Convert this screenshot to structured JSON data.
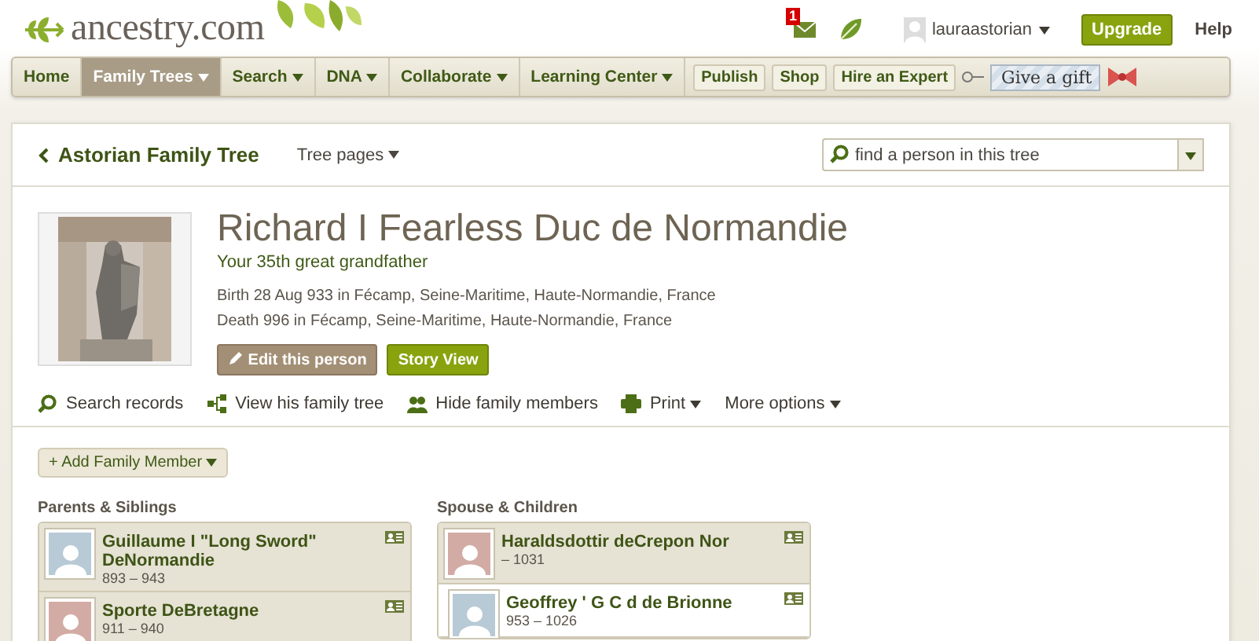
{
  "header": {
    "logo": "ancestry.com",
    "message_count": "1",
    "username": "lauraastorian",
    "upgrade": "Upgrade",
    "help": "Help"
  },
  "nav": [
    {
      "label": "Home",
      "kind": "tab",
      "selected": false,
      "menu": false
    },
    {
      "label": "Family Trees",
      "kind": "tab",
      "selected": true,
      "menu": true
    },
    {
      "label": "Search",
      "kind": "tab",
      "selected": false,
      "menu": true
    },
    {
      "label": "DNA",
      "kind": "tab",
      "selected": false,
      "menu": true
    },
    {
      "label": "Collaborate",
      "kind": "tab",
      "selected": false,
      "menu": true
    },
    {
      "label": "Learning Center",
      "kind": "tab",
      "selected": false,
      "menu": true
    },
    {
      "label": "Publish",
      "kind": "button",
      "selected": false,
      "menu": false
    },
    {
      "label": "Shop",
      "kind": "button",
      "selected": false,
      "menu": false
    },
    {
      "label": "Hire an Expert",
      "kind": "button",
      "selected": false,
      "menu": false
    },
    {
      "label": "Give a gift",
      "kind": "gift",
      "selected": false,
      "menu": false
    }
  ],
  "tree": {
    "title": "Astorian Family Tree",
    "pages_menu": "Tree pages",
    "search_placeholder": "find a person in this tree"
  },
  "person": {
    "name": "Richard I Fearless Duc de Normandie",
    "relation": "Your 35th great grandfather",
    "facts": [
      "Birth 28 Aug 933 in Fécamp, Seine-Maritime, Haute-Normandie, France",
      "Death 996 in Fécamp, Seine-Maritime, Haute-Normandie, France"
    ],
    "edit_button": "Edit this person",
    "story_button": "Story View"
  },
  "actions": [
    {
      "label": "Search records",
      "kind": "search",
      "menu": false
    },
    {
      "label": "View his family tree",
      "kind": "tree",
      "menu": false
    },
    {
      "label": "Hide family members",
      "kind": "people",
      "menu": false
    },
    {
      "label": "Print",
      "kind": "print",
      "menu": true
    },
    {
      "label": "More options",
      "kind": "none",
      "menu": true
    }
  ],
  "family": {
    "add_button": "+ Add Family Member",
    "parents_title": "Parents & Siblings",
    "parents": [
      {
        "name": "Guillaume I \"Long Sword\" DeNormandie",
        "years": "893 – 943",
        "color": "#b7cad6"
      },
      {
        "name": "Sporte DeBretagne",
        "years": "911 – 940",
        "color": "#d3aba5"
      }
    ],
    "spouses_title": "Spouse & Children",
    "spouses": [
      {
        "name": "Haraldsdottir deCrepon Nor",
        "years": "– 1031",
        "color": "#d3aba5",
        "children": [
          {
            "name": "Geoffrey ' G C d de Brionne",
            "years": "953 – 1026",
            "color": "#b7cad6"
          }
        ]
      }
    ]
  }
}
